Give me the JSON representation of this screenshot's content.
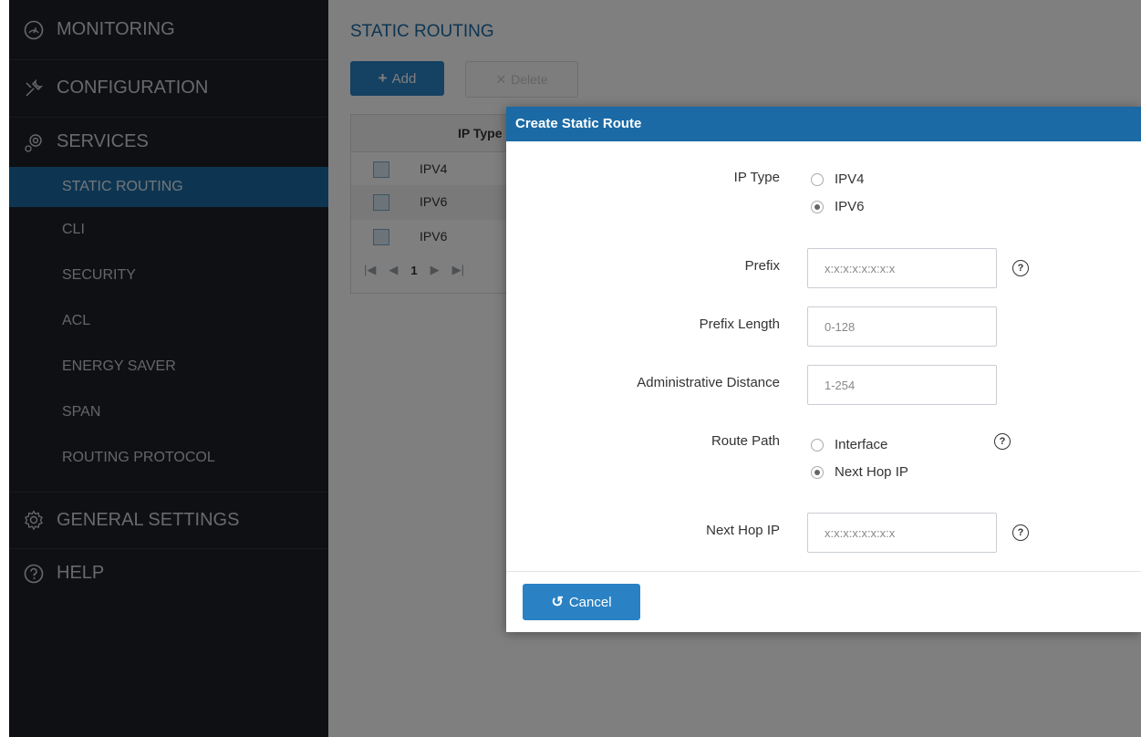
{
  "sidebar": {
    "monitoring": {
      "label": "MONITORING",
      "icon": "gauge-icon"
    },
    "configuration": {
      "label": "CONFIGURATION",
      "icon": "wrench-icon"
    },
    "services": {
      "label": "SERVICES",
      "icon": "gears-icon",
      "items": [
        {
          "label": "STATIC ROUTING",
          "active": true
        },
        {
          "label": "CLI"
        },
        {
          "label": "SECURITY"
        },
        {
          "label": "ACL"
        },
        {
          "label": "ENERGY SAVER"
        },
        {
          "label": "SPAN"
        },
        {
          "label": "ROUTING PROTOCOL"
        }
      ]
    },
    "general_settings": {
      "label": "GENERAL SETTINGS",
      "icon": "gear-icon"
    },
    "help": {
      "label": "HELP",
      "icon": "help-icon"
    }
  },
  "main": {
    "title": "STATIC ROUTING",
    "add_label": "Add",
    "delete_label": "Delete",
    "table": {
      "column": "IP Type",
      "rows": [
        "IPV4",
        "IPV6",
        "IPV6"
      ]
    },
    "pager": {
      "current": "1"
    }
  },
  "modal": {
    "title": "Create Static Route",
    "ip_type": {
      "label": "IP Type",
      "options": [
        "IPV4",
        "IPV6"
      ],
      "selected": "IPV6"
    },
    "prefix": {
      "label": "Prefix",
      "placeholder": "x:x:x:x:x:x:x:x"
    },
    "prefix_length": {
      "label": "Prefix Length",
      "placeholder": "0-128"
    },
    "admin_distance": {
      "label": "Administrative Distance",
      "placeholder": "1-254"
    },
    "route_path": {
      "label": "Route Path",
      "options": [
        "Interface",
        "Next Hop IP"
      ],
      "selected": "Next Hop IP"
    },
    "next_hop": {
      "label": "Next Hop IP",
      "placeholder": "x:x:x:x:x:x:x:x"
    },
    "cancel_label": "Cancel"
  },
  "colors": {
    "accent": "#1b6aa5",
    "button": "#2a82c5",
    "sidebar_bg": "#1f2127"
  }
}
